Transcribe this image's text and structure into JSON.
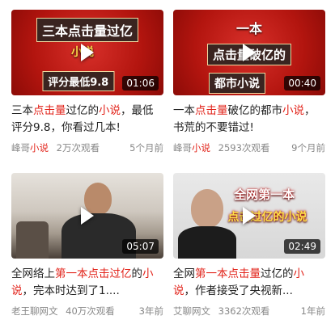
{
  "videos": [
    {
      "thumb_lines": [
        "三本点击量过亿",
        "小说",
        "评分最低9.8"
      ],
      "duration": "01:06",
      "title_parts": [
        {
          "text": "三本",
          "hl": false
        },
        {
          "text": "点击量",
          "hl": true
        },
        {
          "text": "过亿的",
          "hl": false
        },
        {
          "text": "小说",
          "hl": true
        },
        {
          "text": "，最低评分9.8，你看过几本!",
          "hl": false
        }
      ],
      "author_prefix": "峰哥",
      "author_hl": "小说",
      "views": "2万次观看",
      "time": "5个月前"
    },
    {
      "thumb_lines": [
        "一本",
        "点击量破亿的",
        "都市小说"
      ],
      "duration": "00:40",
      "title_parts": [
        {
          "text": "一本",
          "hl": false
        },
        {
          "text": "点击量",
          "hl": true
        },
        {
          "text": "破亿的都市",
          "hl": false
        },
        {
          "text": "小说",
          "hl": true
        },
        {
          "text": "，书荒的不要错过!",
          "hl": false
        }
      ],
      "author_prefix": "峰哥",
      "author_hl": "小说",
      "views": "2593次观看",
      "time": "9个月前"
    },
    {
      "thumb_lines": [],
      "duration": "05:07",
      "title_parts": [
        {
          "text": "全网络上",
          "hl": false
        },
        {
          "text": "第一本点击过亿",
          "hl": true
        },
        {
          "text": "的",
          "hl": false
        },
        {
          "text": "小说",
          "hl": true
        },
        {
          "text": "，完本时达到了1....",
          "hl": false
        }
      ],
      "author_prefix": "老王聊网文",
      "author_hl": "",
      "views": "40万次观看",
      "time": "3年前"
    },
    {
      "thumb_lines": [
        "全网第一本",
        "点击过亿的小说"
      ],
      "duration": "02:49",
      "title_parts": [
        {
          "text": "全网",
          "hl": false
        },
        {
          "text": "第一本",
          "hl": true
        },
        {
          "text": "点击量",
          "hl": true
        },
        {
          "text": "过亿的",
          "hl": false
        },
        {
          "text": "小说",
          "hl": true
        },
        {
          "text": "，作者接受了央视新...",
          "hl": false
        }
      ],
      "author_prefix": "艾聊网文",
      "author_hl": "",
      "views": "3362次观看",
      "time": "1年前"
    }
  ]
}
